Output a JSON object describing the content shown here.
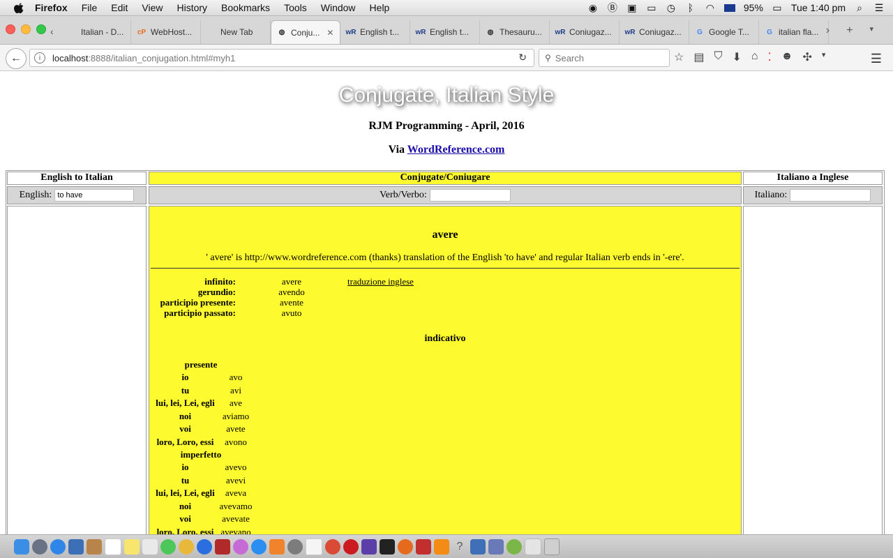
{
  "menubar": {
    "app": "Firefox",
    "items": [
      "File",
      "Edit",
      "View",
      "History",
      "Bookmarks",
      "Tools",
      "Window",
      "Help"
    ],
    "status": {
      "battery": "95%",
      "clock": "Tue 1:40 pm"
    }
  },
  "tabs": [
    {
      "label": "Italian - D...",
      "icon": "page-icon"
    },
    {
      "label": "WebHost...",
      "icon": "cpanel-icon"
    },
    {
      "label": "New Tab",
      "icon": ""
    },
    {
      "label": "Conju...",
      "icon": "globe-icon",
      "active": true
    },
    {
      "label": "English t...",
      "icon": "wordreference-icon"
    },
    {
      "label": "English t...",
      "icon": "wordreference-icon"
    },
    {
      "label": "Thesauru...",
      "icon": "globe-icon"
    },
    {
      "label": "Coniugaz...",
      "icon": "wordreference-icon"
    },
    {
      "label": "Coniugaz...",
      "icon": "wordreference-icon"
    },
    {
      "label": "Google T...",
      "icon": "google-translate-icon"
    },
    {
      "label": "italian fla...",
      "icon": "google-icon"
    }
  ],
  "navbar": {
    "url_host": "localhost",
    "url_path": ":8888/italian_conjugation.html#myh1",
    "search_placeholder": "Search"
  },
  "page": {
    "title": "Conjugate, Italian Style",
    "byline": "RJM Programming - April, 2016",
    "via_prefix": "Via ",
    "via_link": "WordReference.com",
    "headers": {
      "left": "English to Italian",
      "middle": "Conjugate/Coniugare",
      "right": "Italiano a Inglese"
    },
    "inputs": {
      "english_label": "English:",
      "english_value": "to have",
      "verb_label": "Verb/Verbo:",
      "verb_value": "",
      "italiano_label": "Italiano:",
      "italiano_value": ""
    },
    "verb": "avere",
    "description": "' avere' is http://www.wordreference.com (thanks) translation of the English 'to have' and regular Italian verb ends in '-ere'.",
    "forms": [
      {
        "label": "infinito:",
        "value": "avere"
      },
      {
        "label": "gerundio:",
        "value": "avendo"
      },
      {
        "label": "participio presente:",
        "value": "avente"
      },
      {
        "label": "participio passato:",
        "value": "avuto"
      }
    ],
    "translation_link": "traduzione inglese",
    "mood": "indicativo",
    "tenses": [
      {
        "name": "presente",
        "rows": [
          {
            "pron": "io",
            "form": "avo"
          },
          {
            "pron": "tu",
            "form": "avi"
          },
          {
            "pron": "lui, lei, Lei, egli",
            "form": "ave"
          },
          {
            "pron": "noi",
            "form": "aviamo"
          },
          {
            "pron": "voi",
            "form": "avete"
          },
          {
            "pron": "loro, Loro, essi",
            "form": "avono"
          }
        ]
      },
      {
        "name": "imperfetto",
        "rows": [
          {
            "pron": "io",
            "form": "avevo"
          },
          {
            "pron": "tu",
            "form": "avevi"
          },
          {
            "pron": "lui, lei, Lei, egli",
            "form": "aveva"
          },
          {
            "pron": "noi",
            "form": "avevamo"
          },
          {
            "pron": "voi",
            "form": "avevate"
          },
          {
            "pron": "loro, Loro, essi",
            "form": "avevano"
          }
        ]
      }
    ]
  }
}
